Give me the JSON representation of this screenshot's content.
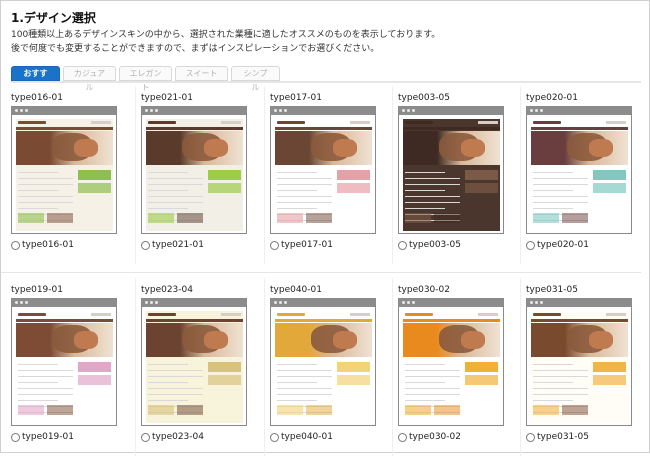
{
  "page": {
    "title": "1.デザイン選択",
    "description_line1": "100種類以上あるデザインスキンの中から、選択された業種に適したオススメのものを表示しております。",
    "description_line2": "後で何度でも変更することができますので、まずはインスピレーションでお選びください。"
  },
  "tabs": [
    {
      "label": "おすすめ",
      "active": true
    },
    {
      "label": "カジュアル",
      "active": false
    },
    {
      "label": "エレガント",
      "active": false
    },
    {
      "label": "スイート",
      "active": false
    },
    {
      "label": "シンプル",
      "active": false
    }
  ],
  "designs": [
    [
      {
        "id": "type016-01",
        "label": "type016-01",
        "radio_label": "type016-01",
        "theme": "#7b4a33",
        "accent": "#8fbf4f",
        "bg": "#f6f1e6"
      },
      {
        "id": "type021-01",
        "label": "type021-01",
        "radio_label": "type021-01",
        "theme": "#5a3a2a",
        "accent": "#9ccc48",
        "bg": "#f1efe6"
      },
      {
        "id": "type017-01",
        "label": "type017-01",
        "radio_label": "type017-01",
        "theme": "#6b4634",
        "accent": "#e8a0a8",
        "bg": "#ffffff"
      },
      {
        "id": "type003-05",
        "label": "type003-05",
        "radio_label": "type003-05",
        "theme": "#3e2a22",
        "accent": "#7a5a46",
        "bg": "#4a362c"
      },
      {
        "id": "type020-01",
        "label": "type020-01",
        "radio_label": "type020-01",
        "theme": "#6a3e3e",
        "accent": "#7fc9c0",
        "bg": "#ffffff"
      }
    ],
    [
      {
        "id": "type019-01",
        "label": "type019-01",
        "radio_label": "type019-01",
        "theme": "#7e4b35",
        "accent": "#e3a6c9",
        "bg": "#ffffff"
      },
      {
        "id": "type023-04",
        "label": "type023-04",
        "radio_label": "type023-04",
        "theme": "#6b4330",
        "accent": "#d9c27a",
        "bg": "#f8f4dc"
      },
      {
        "id": "type040-01",
        "label": "type040-01",
        "radio_label": "type040-01",
        "theme": "#e2a93a",
        "accent": "#f3d27a",
        "bg": "#ffffff"
      },
      {
        "id": "type030-02",
        "label": "type030-02",
        "radio_label": "type030-02",
        "theme": "#e98a1e",
        "accent": "#f0b03a",
        "bg": "#ffffff"
      },
      {
        "id": "type031-05",
        "label": "type031-05",
        "radio_label": "type031-05",
        "theme": "#7a4a2f",
        "accent": "#f4b24a",
        "bg": "#fffdf5"
      }
    ]
  ]
}
